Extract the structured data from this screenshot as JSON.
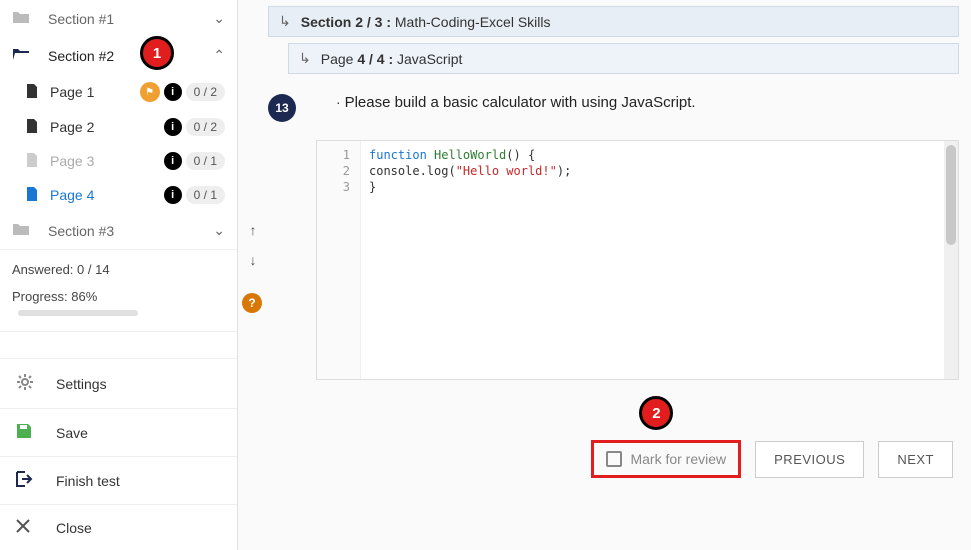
{
  "sidebar": {
    "sections": [
      {
        "label": "Section #1",
        "expanded": false
      },
      {
        "label": "Section #2",
        "expanded": true
      },
      {
        "label": "Section #3",
        "expanded": false
      }
    ],
    "pages": [
      {
        "label": "Page 1",
        "count": "0 / 2",
        "flagged": true
      },
      {
        "label": "Page 2",
        "count": "0 / 2"
      },
      {
        "label": "Page 3",
        "count": "0 / 1",
        "dim": true
      },
      {
        "label": "Page 4",
        "count": "0 / 1",
        "active": true
      }
    ],
    "answered_label": "Answered: 0 / 14",
    "progress_label": "Progress: 86%",
    "progress_pct": 86,
    "actions": {
      "settings": "Settings",
      "save": "Save",
      "finish": "Finish test",
      "close": "Close"
    }
  },
  "breadcrumb": {
    "section_prefix": "Section",
    "section_count": "2 / 3 :",
    "section_name": "Math-Coding-Excel Skills",
    "page_prefix": "Page",
    "page_count": "4 / 4 :",
    "page_name": "JavaScript"
  },
  "question": {
    "number": "13",
    "bullet": "·",
    "text": "Please build a basic calculator with using JavaScript."
  },
  "code": {
    "line1_kw": "function",
    "line1_fn": "HelloWorld",
    "line1_rest": "() {",
    "line2_pre": "    console.log(",
    "line2_str": "\"Hello world!\"",
    "line2_post": ");",
    "line3": "}",
    "ln1": "1",
    "ln2": "2",
    "ln3": "3"
  },
  "footer": {
    "mark": "Mark for review",
    "prev": "PREVIOUS",
    "next": "NEXT"
  },
  "callouts": {
    "one": "1",
    "two": "2"
  },
  "icons": {
    "chev_down": "⌄",
    "chev_up": "⌃",
    "info": "i",
    "help": "?",
    "return": "↳",
    "up": "↑",
    "down": "↓"
  }
}
